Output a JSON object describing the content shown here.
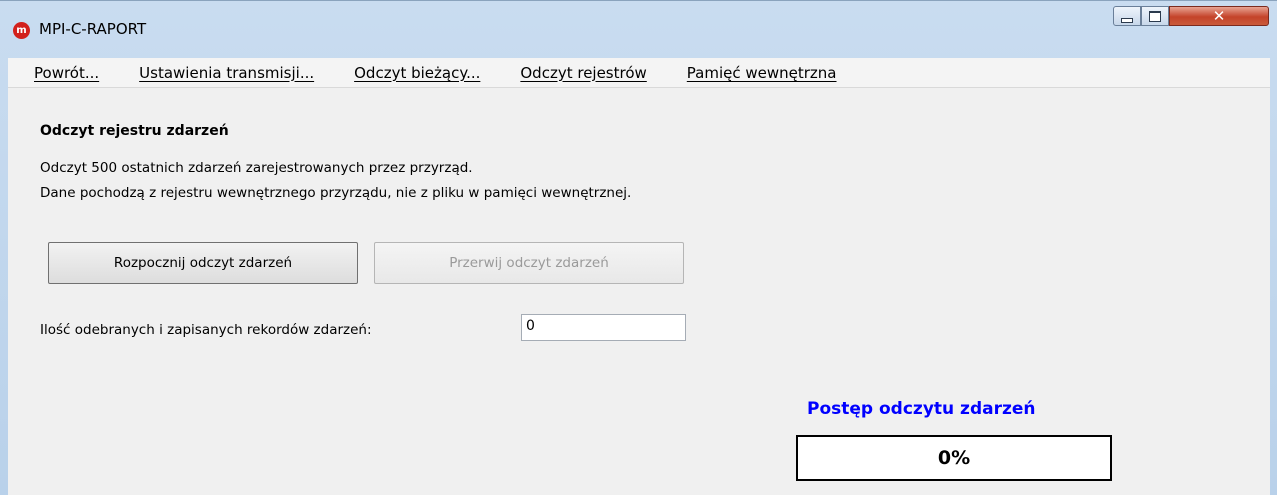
{
  "window": {
    "title": "MPI-C-RAPORT",
    "app_icon_text": "m",
    "controls": {
      "minimize_icon": "minimize-icon",
      "maximize_icon": "maximize-icon",
      "close_icon": "close-icon"
    }
  },
  "menu": {
    "items": [
      {
        "label": "Powrót..."
      },
      {
        "label": "Ustawienia transmisji..."
      },
      {
        "label": "Odczyt bieżący..."
      },
      {
        "label": "Odczyt rejestrów"
      },
      {
        "label": "Pamięć wewnętrzna"
      }
    ]
  },
  "content": {
    "heading": "Odczyt rejestru zdarzeń",
    "description_line1": "Odczyt 500 ostatnich zdarzeń zarejestrowanych przez przyrząd.",
    "description_line2": "Dane pochodzą z rejestru wewnętrznego przyrządu, nie z pliku w pamięci wewnętrznej.",
    "start_button": "Rozpocznij odczyt zdarzeń",
    "stop_button": "Przerwij odczyt zdarzeń",
    "stop_button_enabled": false,
    "records_label": "Ilość odebranych i zapisanych rekordów zdarzeń:",
    "records_value": "0",
    "progress_title": "Postęp odczytu zdarzeń",
    "progress_text": "0%",
    "progress_value": 0
  },
  "colors": {
    "progress_title": "#0000ff",
    "close_button": "#c4432a",
    "app_icon": "#d2201c"
  }
}
